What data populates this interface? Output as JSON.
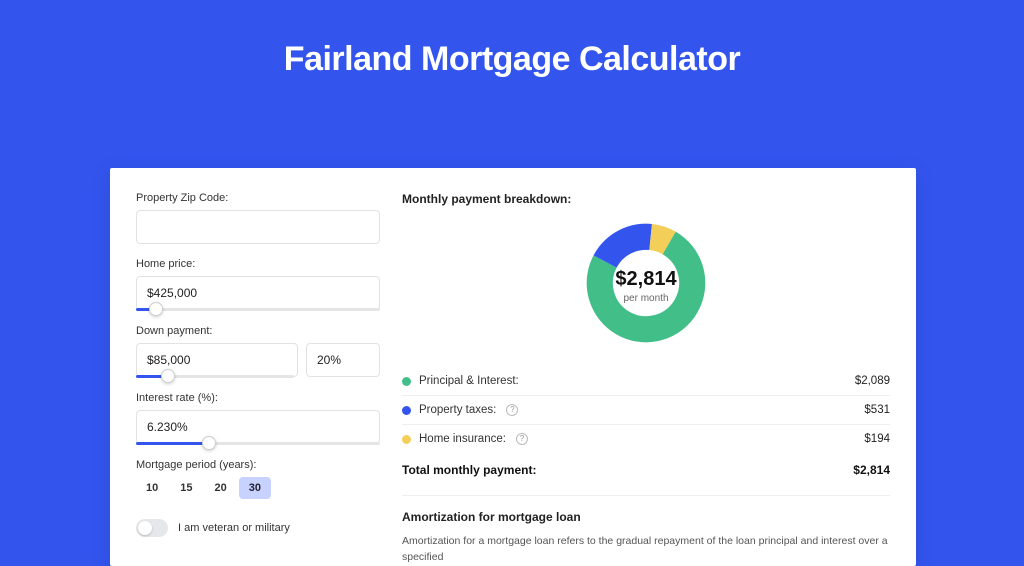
{
  "title": "Fairland Mortgage Calculator",
  "form": {
    "zip_label": "Property Zip Code:",
    "zip_value": "",
    "price_label": "Home price:",
    "price_value": "$425,000",
    "price_slider_pct": 8,
    "dp_label": "Down payment:",
    "dp_value": "$85,000",
    "dp_pct_value": "20%",
    "dp_slider_pct": 20,
    "rate_label": "Interest rate (%):",
    "rate_value": "6.230%",
    "rate_slider_pct": 30,
    "period_label": "Mortgage period (years):",
    "period_options": [
      "10",
      "15",
      "20",
      "30"
    ],
    "period_active_index": 3,
    "vet_label": "I am veteran or military",
    "vet_on": false
  },
  "breakdown": {
    "heading": "Monthly payment breakdown:",
    "center_value": "$2,814",
    "center_sub": "per month",
    "items": [
      {
        "label": "Principal & Interest:",
        "value": "$2,089",
        "color": "#42bf88",
        "info": false,
        "amount": 2089
      },
      {
        "label": "Property taxes:",
        "value": "$531",
        "color": "#3355ee",
        "info": true,
        "amount": 531
      },
      {
        "label": "Home insurance:",
        "value": "$194",
        "color": "#f3cf5a",
        "info": true,
        "amount": 194
      }
    ],
    "total_label": "Total monthly payment:",
    "total_value": "$2,814"
  },
  "amort": {
    "heading": "Amortization for mortgage loan",
    "text": "Amortization for a mortgage loan refers to the gradual repayment of the loan principal and interest over a specified"
  },
  "chart_data": {
    "type": "pie",
    "title": "Monthly payment breakdown",
    "categories": [
      "Principal & Interest",
      "Property taxes",
      "Home insurance"
    ],
    "values": [
      2089,
      531,
      194
    ],
    "colors": [
      "#42bf88",
      "#3355ee",
      "#f3cf5a"
    ],
    "center_label": "$2,814 per month",
    "donut": true
  }
}
